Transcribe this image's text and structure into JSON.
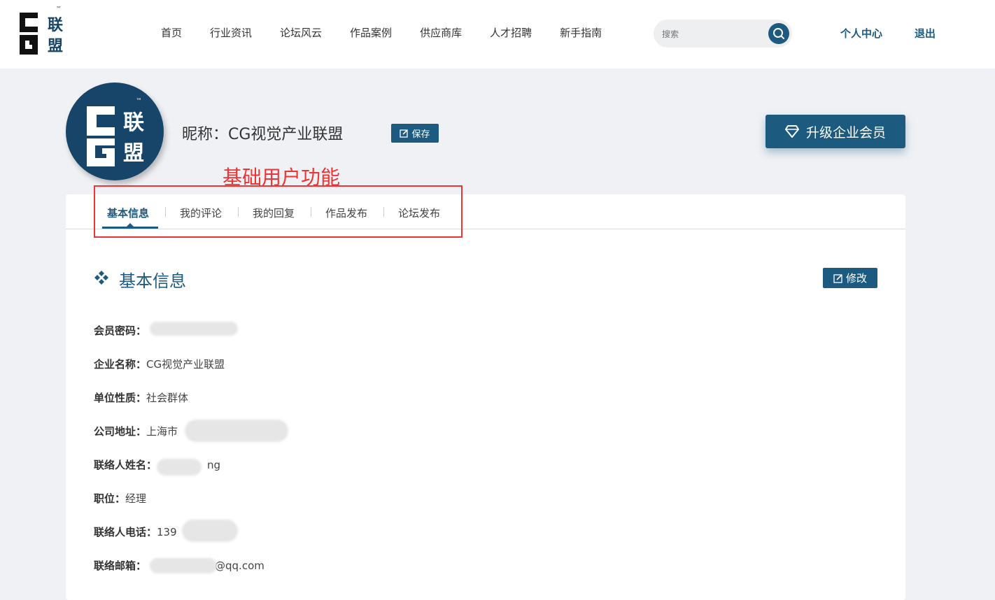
{
  "colors": {
    "brand": "#1d5a80",
    "annotation": "#ee3535",
    "page_bg": "#f0f1f5"
  },
  "logo": {
    "text_top": "联",
    "text_bottom": "盟",
    "tm": "™",
    "icon": "cg-alliance-logo"
  },
  "nav": {
    "items": [
      "首页",
      "行业资讯",
      "论坛风云",
      "作品案例",
      "供应商库",
      "人才招聘",
      "新手指南"
    ]
  },
  "search": {
    "placeholder": "搜索",
    "icon": "search-icon"
  },
  "user_menu": {
    "personal_center": "个人中心",
    "logout": "退出"
  },
  "profile": {
    "nickname": "昵称：CG视觉产业联盟",
    "save_label": "保存",
    "upgrade_label": "升级企业会员",
    "upgrade_icon": "diamond-icon"
  },
  "annotation": {
    "label": "基础用户功能"
  },
  "tabs": [
    {
      "label": "基本信息",
      "active": true
    },
    {
      "label": "我的评论"
    },
    {
      "label": "我的回复"
    },
    {
      "label": "作品发布"
    },
    {
      "label": "论坛发布"
    }
  ],
  "section": {
    "title": "基本信息",
    "icon": "diamond-bullet-icon",
    "edit_label": "修改"
  },
  "info": {
    "password": {
      "label": "会员密码：",
      "value": ""
    },
    "company": {
      "label": "企业名称：",
      "value": "CG视觉产业联盟"
    },
    "org_type": {
      "label": "单位性质：",
      "value": "社会群体"
    },
    "address": {
      "label": "公司地址：",
      "value": "上海市"
    },
    "contact_name": {
      "label": "联络人姓名：",
      "value": "ng"
    },
    "position": {
      "label": "职位：",
      "value": "经理"
    },
    "phone": {
      "label": "联络人电话：",
      "value": "139"
    },
    "email": {
      "label": "联络邮箱：",
      "value": "@qq.com"
    }
  }
}
